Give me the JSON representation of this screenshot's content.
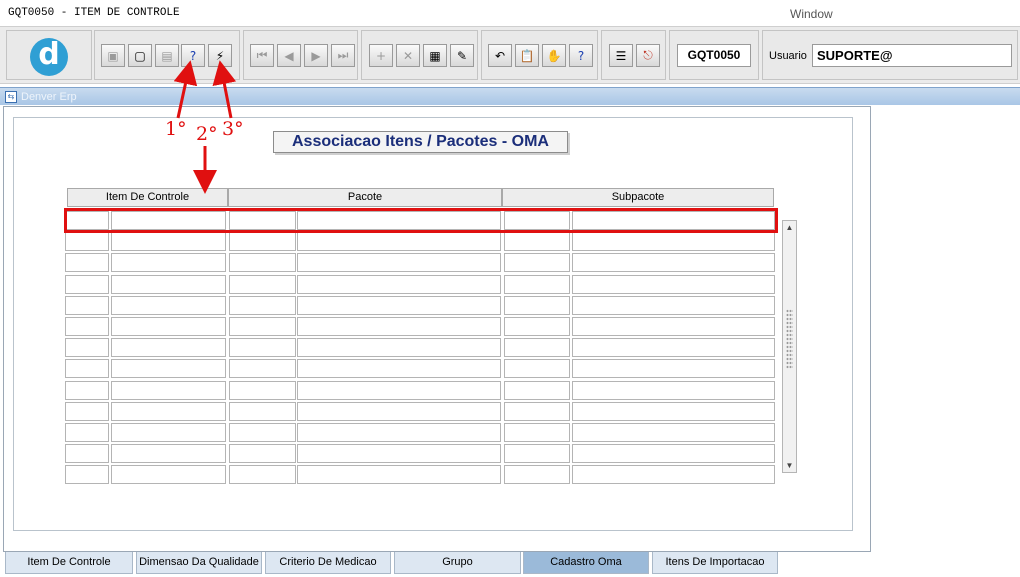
{
  "app_title": "GQT0050 - ITEM DE CONTROLE",
  "window_menu": "Window",
  "logo_letter": "d",
  "toolbar": {
    "module_code": "GQT0050",
    "user_label": "Usuario",
    "user_value": "SUPORTE@",
    "buttons": [
      {
        "name": "save-icon",
        "glyph": "▣",
        "enabled": false
      },
      {
        "name": "screen-icon",
        "glyph": "▢",
        "enabled": true
      },
      {
        "name": "print-icon",
        "glyph": "▤",
        "enabled": false
      },
      {
        "name": "enter-query-icon",
        "glyph": "?",
        "enabled": true
      },
      {
        "name": "execute-query-icon",
        "glyph": "⚡",
        "enabled": true
      },
      {
        "name": "first-record-icon",
        "glyph": "⏮",
        "enabled": false
      },
      {
        "name": "previous-record-icon",
        "glyph": "◀",
        "enabled": false
      },
      {
        "name": "next-record-icon",
        "glyph": "▶",
        "enabled": false
      },
      {
        "name": "last-record-icon",
        "glyph": "⏭",
        "enabled": false
      },
      {
        "name": "insert-record-icon",
        "glyph": "+",
        "enabled": false
      },
      {
        "name": "delete-record-icon",
        "glyph": "✕",
        "enabled": false
      },
      {
        "name": "lov-icon",
        "glyph": "▦",
        "enabled": true
      },
      {
        "name": "edit-icon",
        "glyph": "✎",
        "enabled": true
      },
      {
        "name": "undo-icon",
        "glyph": "↶",
        "enabled": true
      },
      {
        "name": "clipboard-icon",
        "glyph": "📋",
        "enabled": true
      },
      {
        "name": "tools-icon",
        "glyph": "✋",
        "enabled": true
      },
      {
        "name": "help-icon",
        "glyph": "?",
        "enabled": true
      },
      {
        "name": "menu-icon",
        "glyph": "☰",
        "enabled": true
      },
      {
        "name": "exit-icon",
        "glyph": "⎋",
        "enabled": true
      }
    ]
  },
  "frame_title": "Denver Erp",
  "page_title": "Associacao Itens / Pacotes - OMA",
  "columns": [
    "Item De Controle",
    "Pacote",
    "Subpacote"
  ],
  "row_count": 13,
  "annotations": [
    "1°",
    "2°",
    "3°"
  ],
  "tabs": [
    {
      "label": "Item De Controle",
      "active": false
    },
    {
      "label": "Dimensao Da Qualidade",
      "active": false
    },
    {
      "label": "Criterio De Medicao",
      "active": false
    },
    {
      "label": "Grupo",
      "active": false
    },
    {
      "label": "Cadastro Oma",
      "active": true
    },
    {
      "label": "Itens De Importacao",
      "active": false
    }
  ],
  "accent_colors": {
    "annotation": "#e01010",
    "title_text": "#1b2e7a",
    "active_tab": "#9bbad9"
  }
}
